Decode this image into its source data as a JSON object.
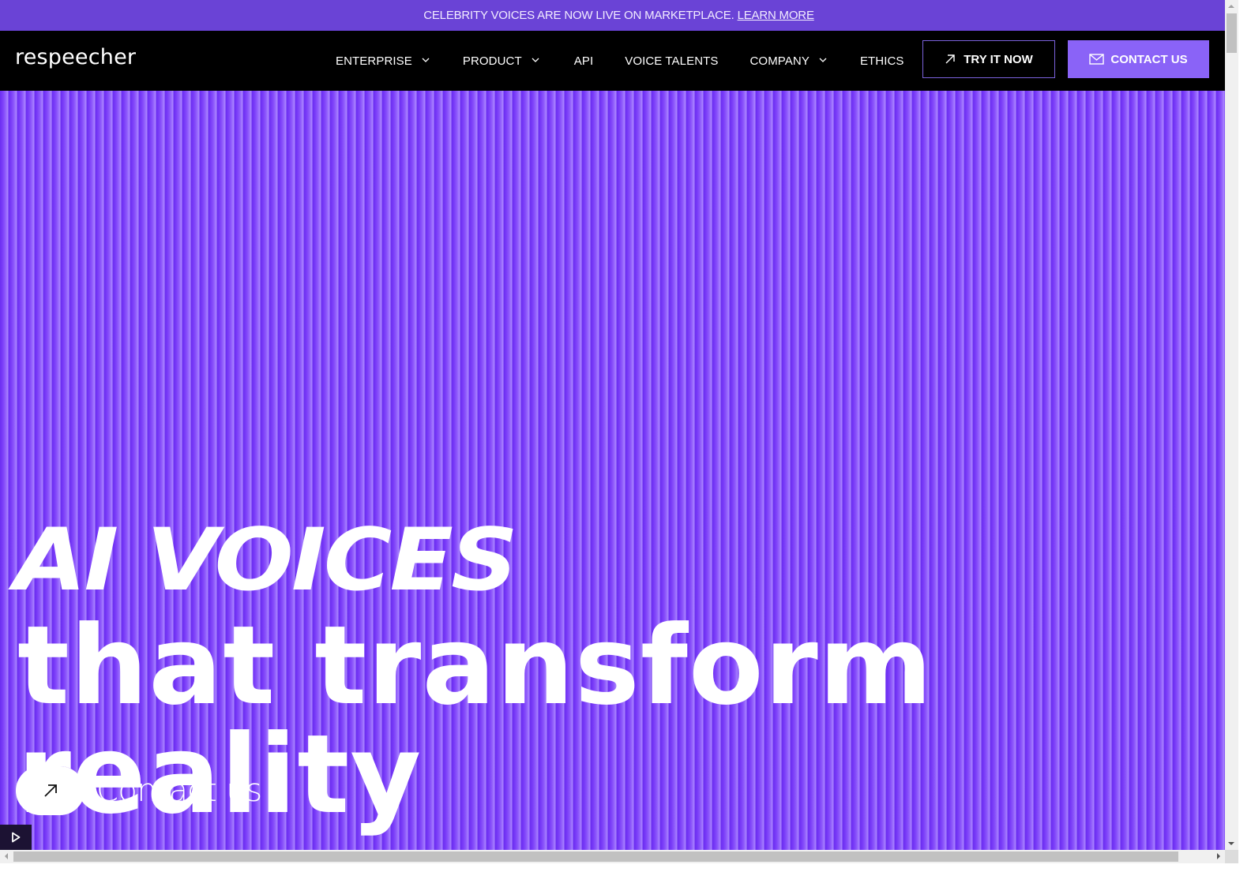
{
  "announcement": {
    "text": "CELEBRITY VOICES ARE NOW LIVE ON MARKETPLACE.",
    "link_label": "LEARN MORE"
  },
  "header": {
    "logo": "respeecher",
    "nav": [
      {
        "label": "ENTERPRISE",
        "has_dropdown": true
      },
      {
        "label": "PRODUCT",
        "has_dropdown": true
      },
      {
        "label": "API",
        "has_dropdown": false
      },
      {
        "label": "VOICE TALENTS",
        "has_dropdown": false
      },
      {
        "label": "COMPANY",
        "has_dropdown": true
      },
      {
        "label": "ETHICS",
        "has_dropdown": false
      }
    ],
    "try_button": {
      "label": "TRY IT NOW",
      "icon": "arrow-up-right-icon"
    },
    "contact_button": {
      "label": "CONTACT US",
      "icon": "mail-icon"
    }
  },
  "hero": {
    "headline_line1": "AI VOICES",
    "headline_line2": "that transform reality",
    "cta": {
      "label": "Contact us",
      "icon": "arrow-up-right-icon"
    },
    "media_control": {
      "icon": "play-icon"
    }
  },
  "colors": {
    "announcement_bg": "#6a43d6",
    "header_bg": "#000000",
    "accent": "#8a63f7",
    "hero_bg": "#7a3cf7",
    "try_border": "#7b62dc"
  }
}
